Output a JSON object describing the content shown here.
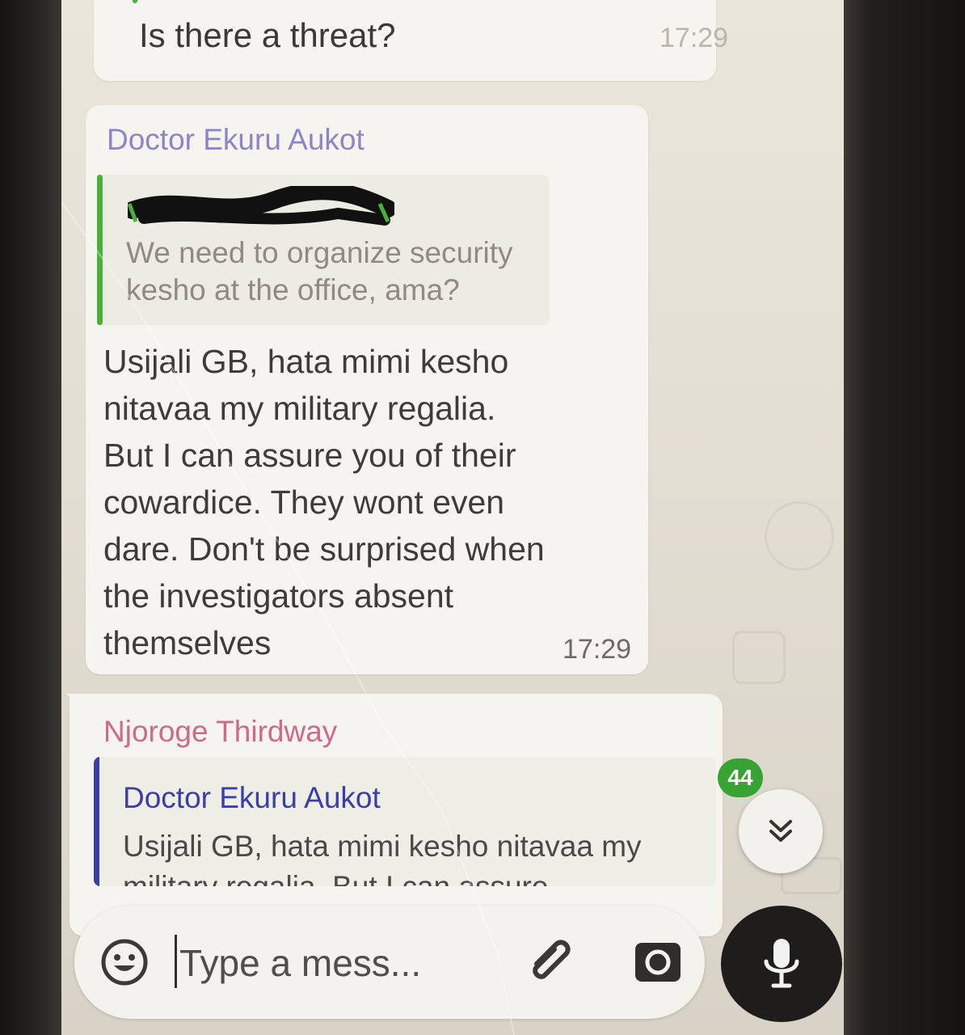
{
  "previous_message": {
    "text": "Is there a threat?",
    "time": "17:29"
  },
  "message": {
    "sender": "Doctor Ekuru Aukot",
    "quoted": {
      "sender_redacted": "redacted phone number",
      "text": "We need to organize security kesho at the office, ama?"
    },
    "body": "Usijali GB, hata mimi kesho\nnitavaa my military regalia.\nBut I can assure you of their\ncowardice. They wont even\ndare. Don't be surprised when\nthe investigators absent\nthemselves",
    "time": "17:29"
  },
  "reply_message": {
    "sender": "Njoroge Thirdway",
    "quoted": {
      "sender": "Doctor Ekuru Aukot",
      "text": "Usijali GB, hata mimi kesho nitavaa my military regalia. But I can assure"
    }
  },
  "unread_count": "44",
  "composer": {
    "placeholder": "Type a mess..."
  },
  "icons": {
    "emoji": "emoji-icon",
    "attach": "paperclip-icon",
    "camera": "camera-icon",
    "mic": "microphone-icon",
    "scroll": "double-chevron-down-icon"
  },
  "colors": {
    "sender_doctor": "#8c86c8",
    "sender_njoroge": "#cf6b8a",
    "quote_bar_green": "#4caf3a",
    "quote_bar_blue": "#3b3ea6",
    "badge": "#36a332"
  }
}
